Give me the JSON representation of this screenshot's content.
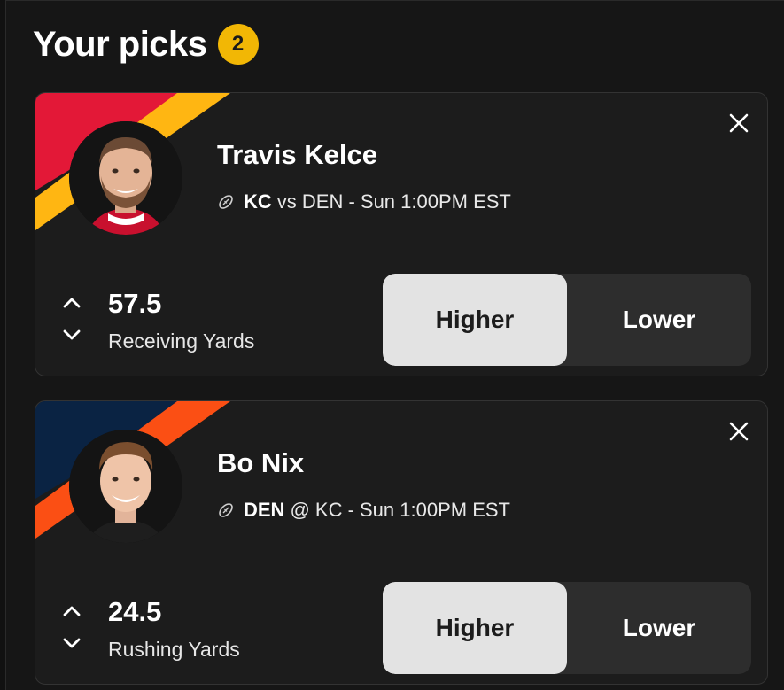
{
  "header": {
    "title": "Your picks",
    "count": "2"
  },
  "picks": [
    {
      "player_name": "Travis Kelce",
      "matchup_team": "KC",
      "matchup_rest": "vs DEN - Sun 1:00PM EST",
      "line": "57.5",
      "stat": "Receiving Yards",
      "higher_label": "Higher",
      "lower_label": "Lower",
      "selected": "Higher",
      "team_colors": [
        "#e31837",
        "#ffb612"
      ],
      "icons": [
        "football-icon",
        "close-icon",
        "chevron-up-icon",
        "chevron-down-icon"
      ]
    },
    {
      "player_name": "Bo Nix",
      "matchup_team": "DEN",
      "matchup_rest": "@ KC - Sun 1:00PM EST",
      "line": "24.5",
      "stat": "Rushing Yards",
      "higher_label": "Higher",
      "lower_label": "Lower",
      "selected": "Higher",
      "team_colors": [
        "#0a2343",
        "#fb4f14"
      ],
      "icons": [
        "football-icon",
        "close-icon",
        "chevron-up-icon",
        "chevron-down-icon"
      ]
    }
  ],
  "colors": {
    "accent_badge": "#f2b705",
    "background": "#161616",
    "card": "#1c1c1c",
    "selected_button": "#e3e3e3",
    "unselected_button": "#2d2d2d"
  }
}
